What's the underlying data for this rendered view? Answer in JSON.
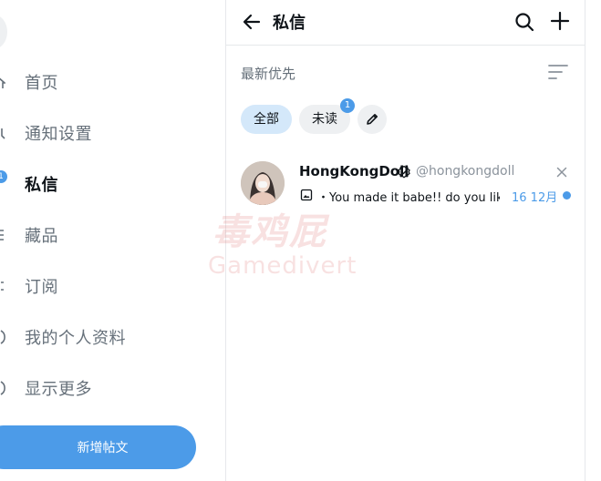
{
  "sidebar": {
    "items": [
      {
        "label": "首页",
        "icon": "home-icon"
      },
      {
        "label": "通知设置",
        "icon": "bell-icon"
      },
      {
        "label": "私信",
        "icon": "mail-icon",
        "badge": "1"
      },
      {
        "label": "藏品",
        "icon": "bookmark-icon"
      },
      {
        "label": "订阅",
        "icon": "list-icon"
      },
      {
        "label": "我的个人资料",
        "icon": "user-icon"
      },
      {
        "label": "显示更多",
        "icon": "more-icon"
      }
    ],
    "new_post_label": "新增帖文"
  },
  "messages": {
    "title": "私信",
    "sort_label": "最新优先",
    "filters": {
      "all": "全部",
      "unread": "未读",
      "unread_badge": "1"
    },
    "conversations": [
      {
        "name": "HongKongDoll",
        "handle": "@hongkongdoll",
        "preview": "・You made it babe!! do you lik…",
        "date": "16 12月",
        "unread": true
      }
    ]
  },
  "watermark": {
    "mark": "毒鸡屁",
    "text": "Gamedivert"
  },
  "colors": {
    "accent": "#4c9be8",
    "chip_active": "#d4e8fa",
    "chip_inactive": "#eef0f2",
    "muted_text": "#66707a"
  }
}
